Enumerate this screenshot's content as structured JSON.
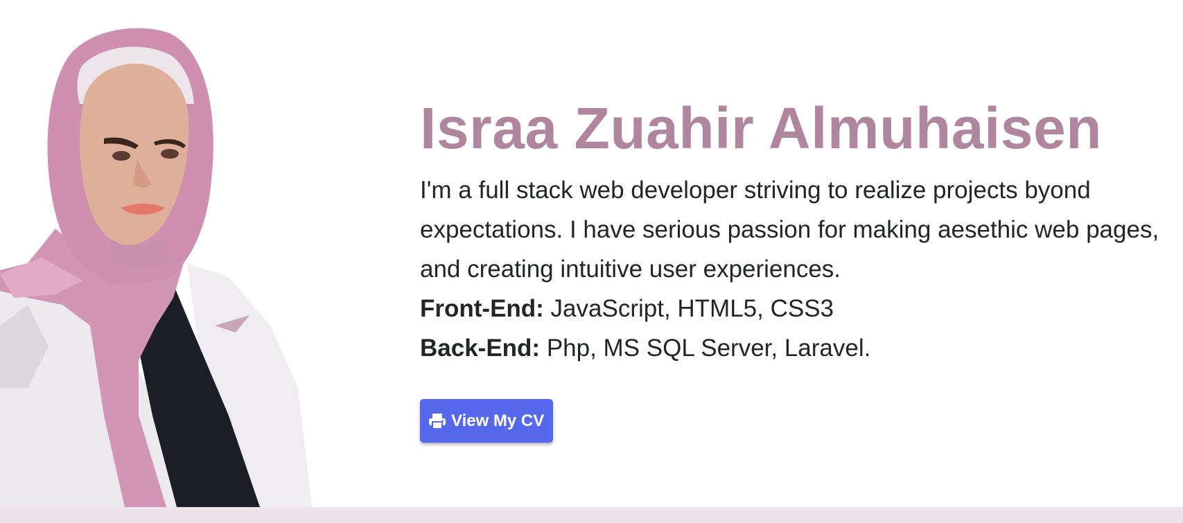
{
  "profile": {
    "name": "Israa Zuahir Almuhaisen",
    "bio": "I'm a full stack web developer striving to realize projects byond expectations. I have serious passion for making aesethic web pages, and creating intuitive user experiences.",
    "skills": [
      {
        "label": "Front-End:",
        "value": " JavaScript, HTML5, CSS3"
      },
      {
        "label": "Back-End:",
        "value": " Php, MS SQL Server, Laravel."
      }
    ]
  },
  "cv_button": {
    "label": "View My CV",
    "icon": "printer-icon",
    "color": "#5668ec"
  },
  "colors": {
    "name": "#b0869f",
    "band": "#ede3ea",
    "text": "#222428"
  }
}
